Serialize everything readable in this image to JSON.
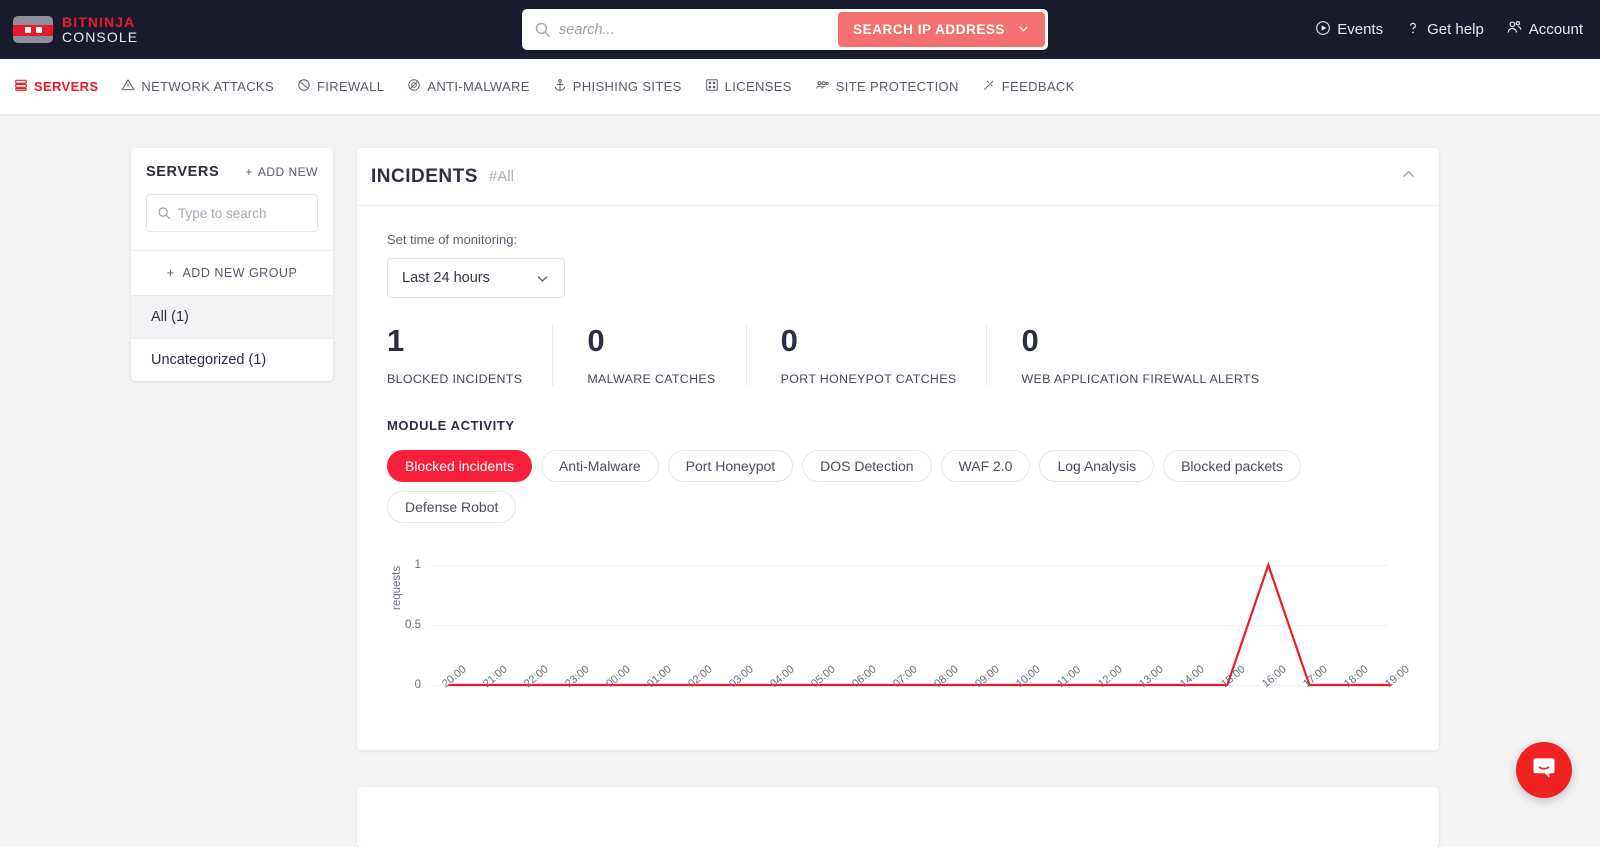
{
  "brand": {
    "line1": "BITNINJA",
    "line2": "CONSOLE"
  },
  "search": {
    "placeholder": "search...",
    "value": "",
    "button_label": "SEARCH IP ADDRESS",
    "icon": "search-icon",
    "chevron": "chevron-down-icon"
  },
  "topnav": [
    {
      "label": "Events",
      "icon": "play-circle-icon"
    },
    {
      "label": "Get help",
      "icon": "question-mark-icon"
    },
    {
      "label": "Account",
      "icon": "users-icon"
    }
  ],
  "subnav": [
    {
      "label": "SERVERS",
      "icon": "server-icon",
      "active": true
    },
    {
      "label": "NETWORK ATTACKS",
      "icon": "warning-triangle-icon",
      "active": false
    },
    {
      "label": "FIREWALL",
      "icon": "firewall-icon",
      "active": false
    },
    {
      "label": "ANTI-MALWARE",
      "icon": "anti-malware-icon",
      "active": false
    },
    {
      "label": "PHISHING SITES",
      "icon": "anchor-icon",
      "active": false
    },
    {
      "label": "LICENSES",
      "icon": "licenses-grid-icon",
      "active": false
    },
    {
      "label": "SITE PROTECTION",
      "icon": "site-protection-icon",
      "active": false
    },
    {
      "label": "FEEDBACK",
      "icon": "feedback-icon",
      "active": false
    }
  ],
  "sidebar": {
    "title": "SERVERS",
    "add_new": "ADD NEW",
    "search_placeholder": "Type to search",
    "search_value": "",
    "add_new_group": "ADD NEW GROUP",
    "groups": [
      {
        "label": "All (1)",
        "selected": true
      },
      {
        "label": "Uncategorized (1)",
        "selected": false
      }
    ]
  },
  "main": {
    "title": "INCIDENTS",
    "subtitle": "#All",
    "collapse_icon": "chevron-up-icon",
    "time_label": "Set time of monitoring:",
    "time_value": "Last 24 hours",
    "stats": [
      {
        "value": "1",
        "label": "BLOCKED INCIDENTS"
      },
      {
        "value": "0",
        "label": "MALWARE CATCHES"
      },
      {
        "value": "0",
        "label": "PORT HONEYPOT CATCHES"
      },
      {
        "value": "0",
        "label": "WEB APPLICATION FIREWALL ALERTS"
      }
    ],
    "module_activity_title": "MODULE ACTIVITY",
    "modules": [
      {
        "label": "Blocked incidents",
        "active": true
      },
      {
        "label": "Anti-Malware",
        "active": false
      },
      {
        "label": "Port Honeypot",
        "active": false
      },
      {
        "label": "DOS Detection",
        "active": false
      },
      {
        "label": "WAF 2.0",
        "active": false
      },
      {
        "label": "Log Analysis",
        "active": false
      },
      {
        "label": "Blocked packets",
        "active": false
      },
      {
        "label": "Defense Robot",
        "active": false
      }
    ]
  },
  "chart_data": {
    "type": "line",
    "title": "",
    "xlabel": "",
    "ylabel": "requests",
    "ylim": [
      0,
      1
    ],
    "yticks": [
      "0",
      "0.5",
      "1"
    ],
    "grid": true,
    "legend": "none",
    "line_color": "#ed1c24",
    "categories": [
      "20:00",
      "21:00",
      "22:00",
      "23:00",
      "00:00",
      "01:00",
      "02:00",
      "03:00",
      "04:00",
      "05:00",
      "06:00",
      "07:00",
      "08:00",
      "09:00",
      "10:00",
      "11:00",
      "12:00",
      "13:00",
      "14:00",
      "15:00",
      "16:00",
      "17:00",
      "18:00",
      "19:00"
    ],
    "series": [
      {
        "name": "Blocked incidents",
        "values": [
          0,
          0,
          0,
          0,
          0,
          0,
          0,
          0,
          0,
          0,
          0,
          0,
          0,
          0,
          0,
          0,
          0,
          0,
          0,
          0,
          1,
          0,
          0,
          0
        ]
      }
    ]
  },
  "intercom": {
    "icon": "chat-bubble-icon",
    "color": "#ef2121"
  },
  "colors": {
    "brand_red": "#e8192c",
    "accent_pill": "#f9203b",
    "search_button": "#f4716f",
    "topbar_bg": "#191a2b",
    "page_bg": "#f4f4f5"
  }
}
